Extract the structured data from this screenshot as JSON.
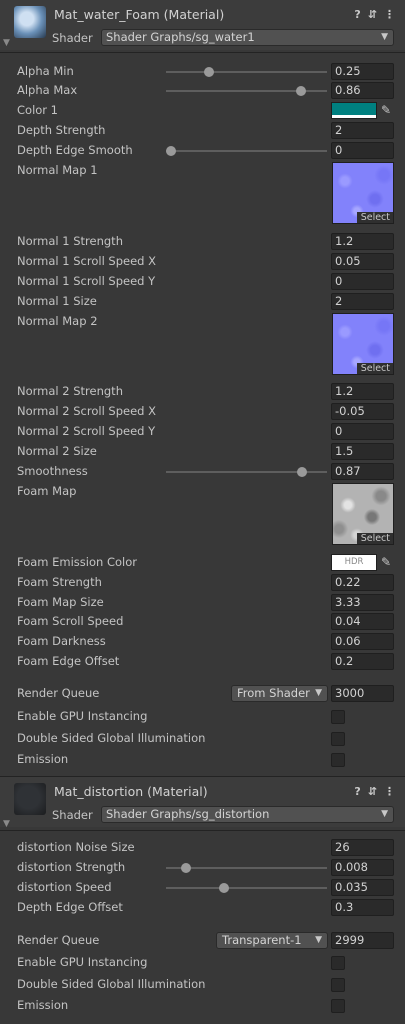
{
  "materials": [
    {
      "title": "Mat_water_Foam (Material)",
      "shader_label": "Shader",
      "shader_value": "Shader Graphs/sg_water1",
      "properties": [
        {
          "label": "Alpha Min",
          "value": "0.25",
          "slider": 0.25
        },
        {
          "label": "Alpha Max",
          "value": "0.86",
          "slider": 0.86
        },
        {
          "label": "Color 1",
          "color": "#008080"
        },
        {
          "label": "Depth Strength",
          "value": "2"
        },
        {
          "label": "Depth Edge Smooth",
          "value": "0",
          "slider": 0
        },
        {
          "label": "Normal Map 1",
          "texture": "normal",
          "select_label": "Select"
        },
        {
          "label": "Normal 1 Strength",
          "value": "1.2"
        },
        {
          "label": "Normal 1 Scroll Speed X",
          "value": "0.05"
        },
        {
          "label": "Normal 1 Scroll Speed Y",
          "value": "0"
        },
        {
          "label": "Normal 1 Size",
          "value": "2"
        },
        {
          "label": "Normal Map 2",
          "texture": "normal",
          "select_label": "Select"
        },
        {
          "label": "Normal 2 Strength",
          "value": "1.2"
        },
        {
          "label": "Normal 2 Scroll Speed X",
          "value": "-0.05"
        },
        {
          "label": "Normal 2 Scroll Speed Y",
          "value": "0"
        },
        {
          "label": "Normal 2 Size",
          "value": "1.5"
        },
        {
          "label": "Smoothness",
          "value": "0.87",
          "slider": 0.87
        },
        {
          "label": "Foam Map",
          "texture": "foam",
          "select_label": "Select"
        },
        {
          "label": "Foam Emission Color",
          "hdr_label": "HDR",
          "color": "#ffffff"
        },
        {
          "label": "Foam Strength",
          "value": "0.22"
        },
        {
          "label": "Foam Map Size",
          "value": "3.33"
        },
        {
          "label": "Foam Scroll Speed",
          "value": "0.04"
        },
        {
          "label": "Foam Darkness",
          "value": "0.06"
        },
        {
          "label": "Foam Edge Offset",
          "value": "0.2"
        }
      ],
      "render_queue_label": "Render Queue",
      "render_queue_mode": "From Shader",
      "render_queue_value": "3000",
      "gpu_instancing_label": "Enable GPU Instancing",
      "gi_label": "Double Sided Global Illumination",
      "emission_label": "Emission"
    },
    {
      "title": "Mat_distortion (Material)",
      "shader_label": "Shader",
      "shader_value": "Shader Graphs/sg_distortion",
      "properties": [
        {
          "label": "distortion Noise Size",
          "value": "26"
        },
        {
          "label": "distortion Strength",
          "value": "0.008",
          "slider": 0.1
        },
        {
          "label": "distortion Speed",
          "value": "0.035",
          "slider": 0.35
        },
        {
          "label": "Depth Edge Offset",
          "value": "0.3"
        }
      ],
      "render_queue_label": "Render Queue",
      "render_queue_mode": "Transparent-1",
      "render_queue_value": "2999",
      "gpu_instancing_label": "Enable GPU Instancing",
      "gi_label": "Double Sided Global Illumination",
      "emission_label": "Emission"
    }
  ],
  "icons": {
    "help": "help-icon",
    "settings": "presets-icon",
    "menu": "kebab-menu-icon",
    "eyedropper": "eyedropper-icon",
    "foldout": "foldout-arrow-icon"
  },
  "colors": {
    "panel_bg": "#383838",
    "field_bg": "#2a2a2a",
    "color1": "#008080",
    "foam_emission": "#ffffff"
  }
}
